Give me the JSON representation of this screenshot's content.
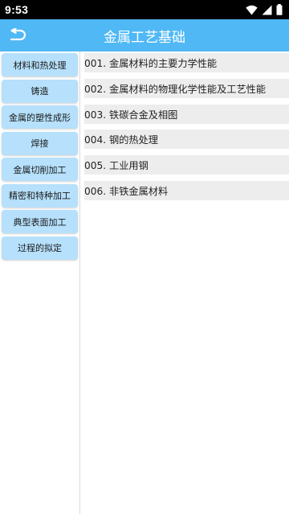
{
  "status": {
    "time": "9:53"
  },
  "appbar": {
    "title": "金属工艺基础"
  },
  "sidebar": {
    "items": [
      {
        "label": "材料和热处理"
      },
      {
        "label": "铸造"
      },
      {
        "label": "金属的塑性成形"
      },
      {
        "label": "焊接"
      },
      {
        "label": "金属切削加工"
      },
      {
        "label": "精密和特种加工"
      },
      {
        "label": "典型表面加工"
      },
      {
        "label": "过程的拟定"
      }
    ]
  },
  "list": {
    "items": [
      {
        "label": "001. 金属材料的主要力学性能"
      },
      {
        "label": "002. 金属材料的物理化学性能及工艺性能"
      },
      {
        "label": "003. 铁碳合金及相图"
      },
      {
        "label": "004. 钢的热处理"
      },
      {
        "label": "005. 工业用钢"
      },
      {
        "label": "006. 非铁金属材料"
      }
    ]
  },
  "colors": {
    "appbar": "#4fb8f5",
    "sidebar_button": "#b6e0fb",
    "list_row": "#ededee"
  }
}
